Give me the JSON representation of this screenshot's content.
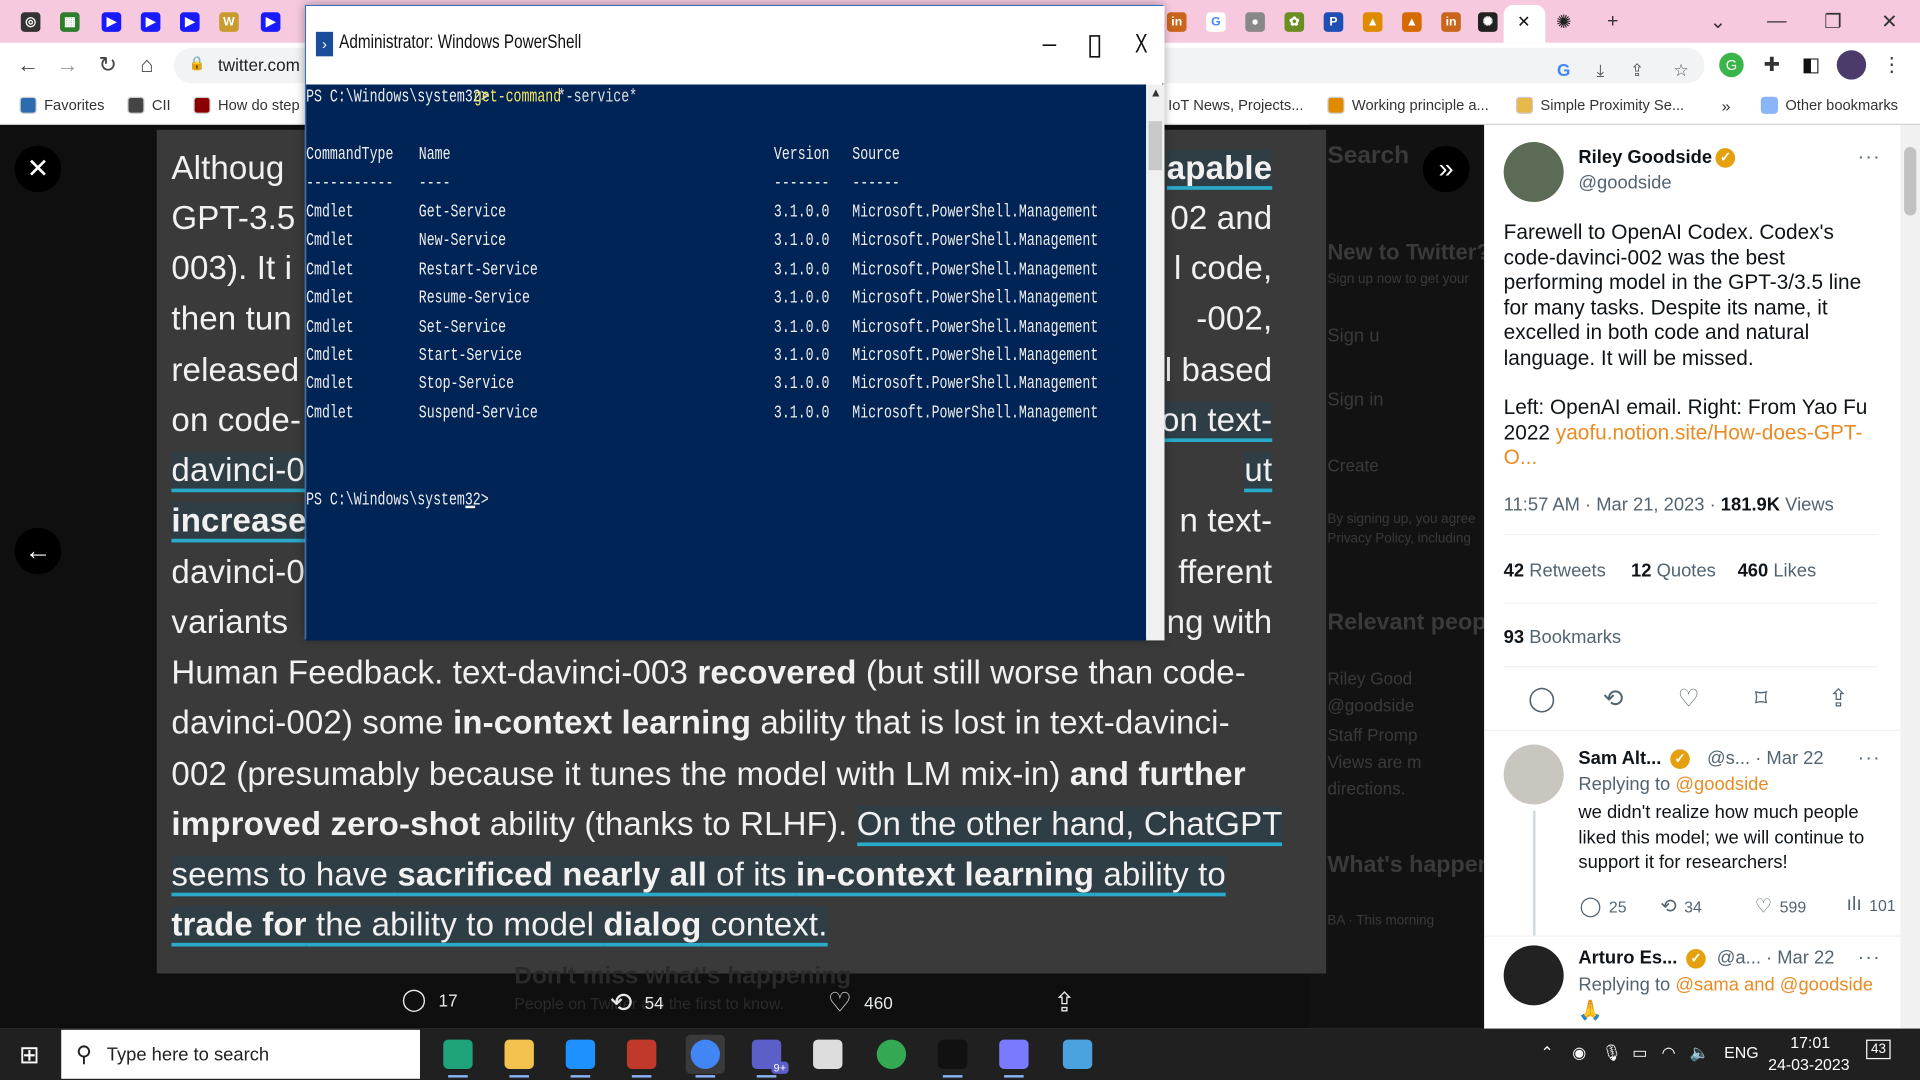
{
  "tabs": {
    "favicons": [
      {
        "name": "firefox-like-icon",
        "color": "#333333",
        "glyph": "◎"
      },
      {
        "name": "windows-tiles-icon",
        "color": "#2d7d2d",
        "glyph": "▦"
      },
      {
        "name": "youtube-icon",
        "color": "#1a1aff",
        "glyph": "▶"
      },
      {
        "name": "youtube-icon",
        "color": "#1a1aff",
        "glyph": "▶"
      },
      {
        "name": "youtube-icon",
        "color": "#1a1aff",
        "glyph": "▶"
      },
      {
        "name": "wordpress-icon",
        "color": "#c99a2e",
        "glyph": "W"
      },
      {
        "name": "youtube-icon",
        "color": "#1a1aff",
        "glyph": "▶"
      }
    ],
    "right_favicons": [
      {
        "name": "linkedin-icon",
        "color": "#c9661b",
        "glyph": "in"
      },
      {
        "name": "google-icon",
        "color": "#ffffff",
        "glyph": "G"
      },
      {
        "name": "globe-icon",
        "color": "#888888",
        "glyph": "●"
      },
      {
        "name": "extension-tab-icon",
        "color": "#6b8e23",
        "glyph": "✿"
      },
      {
        "name": "profile-tab-icon",
        "color": "#1f4fb5",
        "glyph": "P"
      },
      {
        "name": "warning-icon",
        "color": "#e08a00",
        "glyph": "▲"
      },
      {
        "name": "flask-icon",
        "color": "#d46a00",
        "glyph": "▲"
      },
      {
        "name": "linkedin-icon",
        "color": "#c9661b",
        "glyph": "in"
      },
      {
        "name": "openai-icon",
        "color": "#222222",
        "glyph": "✺"
      }
    ],
    "active_close": "✕",
    "after_active": {
      "name": "openai-icon",
      "glyph": "✺"
    },
    "new_tab": "+",
    "dropdown": "⌄",
    "minimize": "—",
    "restore": "❐",
    "close": "✕"
  },
  "toolbar": {
    "back": "←",
    "forward": "→",
    "reload": "↻",
    "home": "⌂",
    "url": "twitter.com",
    "lock": "🔒"
  },
  "bookmarks": [
    {
      "label": "Favorites",
      "color": "#2b6cb0"
    },
    {
      "label": "CII",
      "color": "#444444"
    },
    {
      "label": "How do step",
      "color": "#8b0000"
    },
    {
      "label": "IoT News, Projects...",
      "color": "#ffffff"
    },
    {
      "label": "Working principle a...",
      "color": "#e08a00"
    },
    {
      "label": "Simple Proximity Se...",
      "color": "#e8b84a"
    }
  ],
  "bookmarks_more": "»",
  "other_bookmarks": "Other bookmarks",
  "image_text": [
    [
      {
        "t": "Althoug"
      },
      {
        "t": "apable",
        "h": true,
        "b": true
      }
    ],
    [
      {
        "t": "GPT-3.5"
      },
      {
        "t": "02 and"
      }
    ],
    [
      {
        "t": "003). It i"
      },
      {
        "t": "l code,"
      }
    ],
    [
      {
        "t": "then tun"
      },
      {
        "t": "-002,"
      }
    ],
    [
      {
        "t": "released"
      },
      {
        "t": "del based"
      }
    ],
    [
      {
        "t": "on code-"
      },
      {
        "t": "on text-",
        "h": true
      }
    ],
    [
      {
        "t": "davinci-0",
        "h": true
      },
      {
        "t": "ut",
        "h": true
      }
    ],
    [
      {
        "t": "increase",
        "h": true,
        "b": true
      },
      {
        "t": "n text-"
      }
    ],
    [
      {
        "t": "davinci-0"
      },
      {
        "t": "fferent"
      }
    ],
    [
      {
        "t": "variants"
      },
      {
        "t": "ng with"
      }
    ],
    [
      {
        "t": "Human Feedback. text-davinci-003 "
      },
      {
        "t": "recovered",
        "b": true
      },
      {
        "t": " (but still worse than code-"
      }
    ],
    [
      {
        "t": "davinci-002) some "
      },
      {
        "t": "in-context learning",
        "b": true
      },
      {
        "t": " ability that is lost in text-davinci-"
      }
    ],
    [
      {
        "t": "002 (presumably because it tunes the model with LM mix-in) "
      },
      {
        "t": "and further",
        "b": true
      }
    ],
    [
      {
        "t": "improved zero-shot",
        "b": true
      },
      {
        "t": " ability (thanks to RLHF). "
      },
      {
        "t": "On the other hand, ChatGPT",
        "h": true
      }
    ],
    [
      {
        "t": "seems to have ",
        "h": true
      },
      {
        "t": "sacrificed nearly all",
        "h": true,
        "b": true
      },
      {
        "t": " of its ",
        "h": true
      },
      {
        "t": "in-context learning",
        "h": true,
        "b": true
      },
      {
        "t": " ability to",
        "h": true
      }
    ],
    [
      {
        "t": "trade for",
        "h": true,
        "b": true
      },
      {
        "t": " the ability to model ",
        "h": true
      },
      {
        "t": "dialog",
        "h": true,
        "b": true
      },
      {
        "t": " context.",
        "h": true
      }
    ]
  ],
  "background_twitter": [
    "Search",
    "New to Twitter?",
    "Sign up now to get your",
    "Sign u",
    "Sign in",
    "Create",
    "By signing up, you agree",
    "Privacy Policy, including",
    "Relevant people",
    "Riley Good",
    "@goodside",
    "Staff Promp",
    "Views are m",
    "directions.",
    "What's happening",
    "BA · This morning"
  ],
  "overlay_text": {
    "banner": "Don't miss what's happening",
    "sub": "People on Twitter are the first to know."
  },
  "media": {
    "close": "✕",
    "back": "←",
    "expand": "»"
  },
  "media_actions": {
    "reply": {
      "icon": "💬",
      "count": "17"
    },
    "retweet": {
      "icon": "⟲",
      "count": "54"
    },
    "like": {
      "icon": "♡",
      "count": "460"
    },
    "share": {
      "icon": "⇪"
    }
  },
  "tweet": {
    "name": "Riley Goodside",
    "handle": "@goodside",
    "text1": "Farewell to OpenAI Codex. Codex's code-davinci-002 was the best performing model in the GPT-3/3.5 line for many tasks. Despite its name, it excelled in both code and natural language. It will be missed.",
    "text2": "Left: OpenAI email. Right: From Yao Fu 2022 ",
    "link": "yaofu.notion.site/How-does-GPT-O...",
    "time": "11:57 AM · Mar 21, 2023 · ",
    "views": "181.9K",
    "views_label": " Views",
    "retweets": "42",
    "retweets_label": " Retweets",
    "quotes": "12",
    "quotes_label": " Quotes",
    "likes": "460",
    "likes_label": " Likes",
    "bookmarks": "93",
    "bookmarks_label": " Bookmarks",
    "more": "···"
  },
  "replies": [
    {
      "name": "Sam Alt...",
      "handle": "@s...",
      "date": "· Mar 22",
      "replying": "Replying to ",
      "to": "@goodside",
      "text": "we didn't realize how much people liked this model; we will continue to support it for researchers!",
      "reply": "25",
      "rt": "34",
      "like": "599",
      "views": "101"
    },
    {
      "name": "Arturo Es...",
      "handle": "@a...",
      "date": "· Mar 22",
      "replying": "Replying to ",
      "to": "@sama and @goodside",
      "text": "🙏"
    }
  ],
  "powershell": {
    "title": "Administrator: Windows PowerShell",
    "minimize": "–",
    "maximize": "▯",
    "close": "X",
    "prompt1": "PS C:\\Windows\\system32> ",
    "command": "get-command",
    "arg": " *-service*",
    "headers": [
      "CommandType",
      "Name",
      "Version",
      "Source"
    ],
    "underlines": [
      "-----------",
      "----",
      "-------",
      "------"
    ],
    "rows": [
      [
        "Cmdlet",
        "Get-Service",
        "3.1.0.0",
        "Microsoft.PowerShell.Management"
      ],
      [
        "Cmdlet",
        "New-Service",
        "3.1.0.0",
        "Microsoft.PowerShell.Management"
      ],
      [
        "Cmdlet",
        "Restart-Service",
        "3.1.0.0",
        "Microsoft.PowerShell.Management"
      ],
      [
        "Cmdlet",
        "Resume-Service",
        "3.1.0.0",
        "Microsoft.PowerShell.Management"
      ],
      [
        "Cmdlet",
        "Set-Service",
        "3.1.0.0",
        "Microsoft.PowerShell.Management"
      ],
      [
        "Cmdlet",
        "Start-Service",
        "3.1.0.0",
        "Microsoft.PowerShell.Management"
      ],
      [
        "Cmdlet",
        "Stop-Service",
        "3.1.0.0",
        "Microsoft.PowerShell.Management"
      ],
      [
        "Cmdlet",
        "Suspend-Service",
        "3.1.0.0",
        "Microsoft.PowerShell.Management"
      ]
    ],
    "prompt2": "PS C:\\Windows\\system32>"
  },
  "taskbar": {
    "start": "⊞",
    "search_placeholder": "Type here to search",
    "search_icon": "⚲",
    "apps": [
      {
        "name": "edge-icon",
        "color": "#1fa37a"
      },
      {
        "name": "file-explorer-icon",
        "color": "#f2c14e"
      },
      {
        "name": "sticky-notes-icon",
        "color": "#1e90ff"
      },
      {
        "name": "winrar-icon",
        "color": "#c0392b"
      },
      {
        "name": "chrome-icon",
        "color": "#4285f4"
      },
      {
        "name": "teams-icon",
        "color": "#5b5fc7"
      },
      {
        "name": "settings-icon",
        "color": "#dddddd"
      },
      {
        "name": "chrome-profile-icon",
        "color": "#34a853"
      },
      {
        "name": "terminal-icon",
        "color": "#111111"
      },
      {
        "name": "snipping-tool-icon",
        "color": "#7a7aff"
      },
      {
        "name": "notepad-icon",
        "color": "#4aa3df"
      }
    ],
    "teams_badge": "9+",
    "lang": "ENG",
    "time": "17:01",
    "date": "24-03-2023",
    "notif": "43"
  }
}
